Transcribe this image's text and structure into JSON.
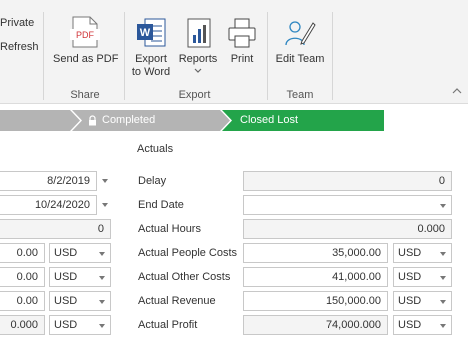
{
  "ribbon": {
    "partial_items": {
      "private": "Private",
      "refresh": "Refresh"
    },
    "share": {
      "send_pdf": "Send as PDF",
      "group_label": "Share"
    },
    "export": {
      "export_word_line1": "Export",
      "export_word_line2": "to Word",
      "reports": "Reports",
      "print": "Print",
      "group_label": "Export"
    },
    "team": {
      "edit_team": "Edit Team",
      "group_label": "Team"
    },
    "pdf_icon_text": "PDF"
  },
  "stages": {
    "completed": "Completed",
    "closed_lost": "Closed Lost"
  },
  "left": {
    "date1": "8/2/2019",
    "date2": "10/24/2020",
    "num0": "0",
    "row4_value": "0.00",
    "row5_value": "0.00",
    "row6_value": "0.00",
    "row7_value": "0.000",
    "currency": "USD"
  },
  "actuals": {
    "title": "Actuals",
    "delay_label": "Delay",
    "delay_value": "0",
    "end_date_label": "End Date",
    "end_date_value": "",
    "hours_label": "Actual Hours",
    "hours_value": "0.000",
    "people_costs_label": "Actual People Costs",
    "people_costs_value": "35,000.00",
    "other_costs_label": "Actual Other Costs",
    "other_costs_value": "41,000.00",
    "revenue_label": "Actual Revenue",
    "revenue_value": "150,000.00",
    "profit_label": "Actual Profit",
    "profit_value": "74,000.000",
    "currency": "USD"
  },
  "colors": {
    "stage_green": "#23a44a",
    "stage_gray": "#b4b4b4",
    "word_blue": "#2b579a",
    "pdf_red": "#d13438",
    "team_blue": "#2e86c1"
  }
}
